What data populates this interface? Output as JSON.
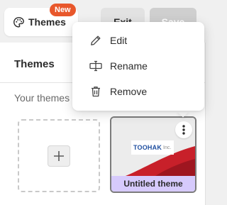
{
  "toolbar": {
    "themes_label": "Themes",
    "new_badge": "New",
    "exit_label": "Exit",
    "save_label": "Save"
  },
  "panel": {
    "title": "Themes",
    "section_label": "Your themes",
    "add_icon": "plus-icon",
    "theme_card": {
      "name": "Untitled theme",
      "logo_main": "TOOHAK",
      "logo_sub": "Inc."
    }
  },
  "menu": {
    "items": [
      {
        "label": "Edit",
        "icon": "pencil-icon"
      },
      {
        "label": "Rename",
        "icon": "rename-icon"
      },
      {
        "label": "Remove",
        "icon": "trash-icon"
      }
    ]
  },
  "colors": {
    "badge": "#e8572b",
    "theme_name_bar": "#d6cafc",
    "preview_red": "#c8202a",
    "logo_blue": "#1f4fa0"
  }
}
